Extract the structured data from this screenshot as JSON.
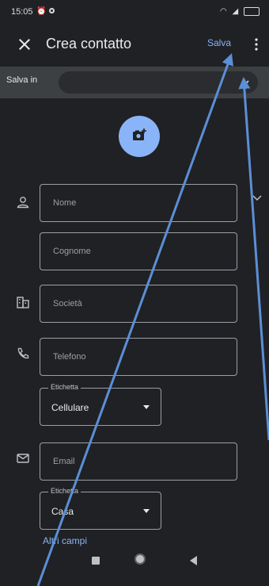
{
  "status_bar": {
    "time": "15:05",
    "icons": [
      "alarm-icon",
      "notification-dot-icon",
      "wifi-icon",
      "signal-icon",
      "battery-icon"
    ]
  },
  "app_bar": {
    "title": "Crea contatto",
    "save_label": "Salva",
    "close_icon": "close-icon",
    "overflow_icon": "more-vert-icon"
  },
  "save_to": {
    "label": "Salva in",
    "value": ""
  },
  "photo": {
    "icon": "add-photo-icon",
    "color": "#8ab4f8"
  },
  "fields": {
    "first_name": {
      "placeholder": "Nome",
      "icon": "person-icon"
    },
    "last_name": {
      "placeholder": "Cognome"
    },
    "company": {
      "placeholder": "Società",
      "icon": "business-icon"
    },
    "phone": {
      "placeholder": "Telefono",
      "icon": "phone-icon"
    },
    "phone_label": {
      "legend": "Etichetta",
      "value": "Cellulare"
    },
    "email": {
      "placeholder": "Email",
      "icon": "mail-icon"
    },
    "email_label": {
      "legend": "Etichetta",
      "value": "Casa"
    }
  },
  "more_fields_label": "Altri campi",
  "colors": {
    "accent": "#8ab4f8",
    "background": "#202124",
    "annotation": "#5b8fd6"
  }
}
